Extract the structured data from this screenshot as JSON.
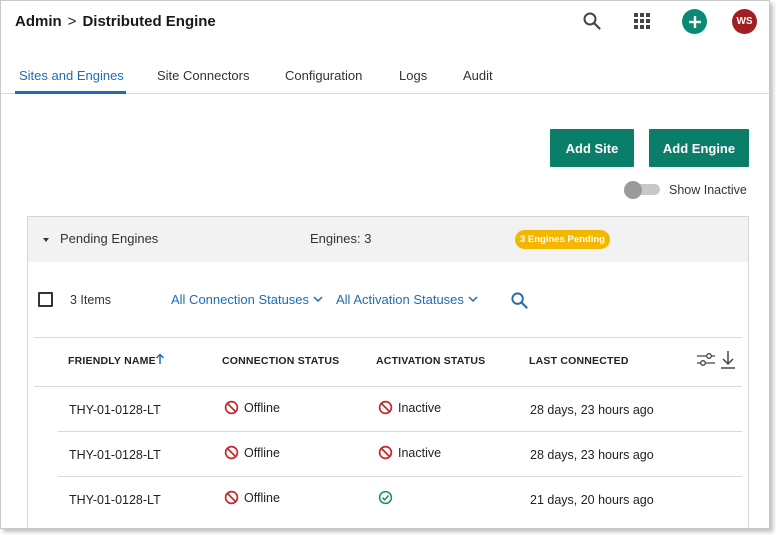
{
  "header": {
    "breadcrumb_root": "Admin",
    "breadcrumb_separator": ">",
    "breadcrumb_current": "Distributed Engine",
    "avatar_initials": "WS",
    "icons": [
      "search-icon",
      "apps-grid-icon",
      "add-icon"
    ]
  },
  "tabs": [
    {
      "label": "Sites and Engines",
      "active": true
    },
    {
      "label": "Site Connectors",
      "active": false
    },
    {
      "label": "Configuration",
      "active": false
    },
    {
      "label": "Logs",
      "active": false
    },
    {
      "label": "Audit",
      "active": false
    }
  ],
  "actions": {
    "add_site": "Add Site",
    "add_engine": "Add Engine",
    "show_inactive_label": "Show Inactive",
    "show_inactive_on": false
  },
  "panel": {
    "title": "Pending Engines",
    "engines_count": "Engines: 3",
    "pending_badge": "3 Engines Pending",
    "items_count": "3 Items",
    "filter_connection": "All Connection Statuses",
    "filter_activation": "All Activation Statuses"
  },
  "table": {
    "columns": [
      "FRIENDLY NAME",
      "CONNECTION STATUS",
      "ACTIVATION STATUS",
      "LAST CONNECTED"
    ],
    "sort_column": "FRIENDLY NAME",
    "sort_direction": "ascending",
    "rows": [
      {
        "name": "THY-01-0128-LT",
        "connection": "Offline",
        "activation": "Inactive",
        "activation_icon": "blocked-icon",
        "last_connected": "28 days, 23 hours ago"
      },
      {
        "name": "THY-01-0128-LT",
        "connection": "Offline",
        "activation": "Inactive",
        "activation_icon": "blocked-icon",
        "last_connected": "28 days, 23 hours ago"
      },
      {
        "name": "THY-01-0128-LT",
        "connection": "Offline",
        "activation": "",
        "activation_icon": "check-circle-icon",
        "last_connected": "21 days, 20 hours ago"
      }
    ]
  },
  "colors": {
    "primary_button": "#0a7e68",
    "link_blue": "#1f6cb3",
    "badge_yellow": "#f3b700",
    "avatar_red": "#a31e22",
    "blocked_red": "#c62828",
    "check_green": "#1b8a6b"
  }
}
